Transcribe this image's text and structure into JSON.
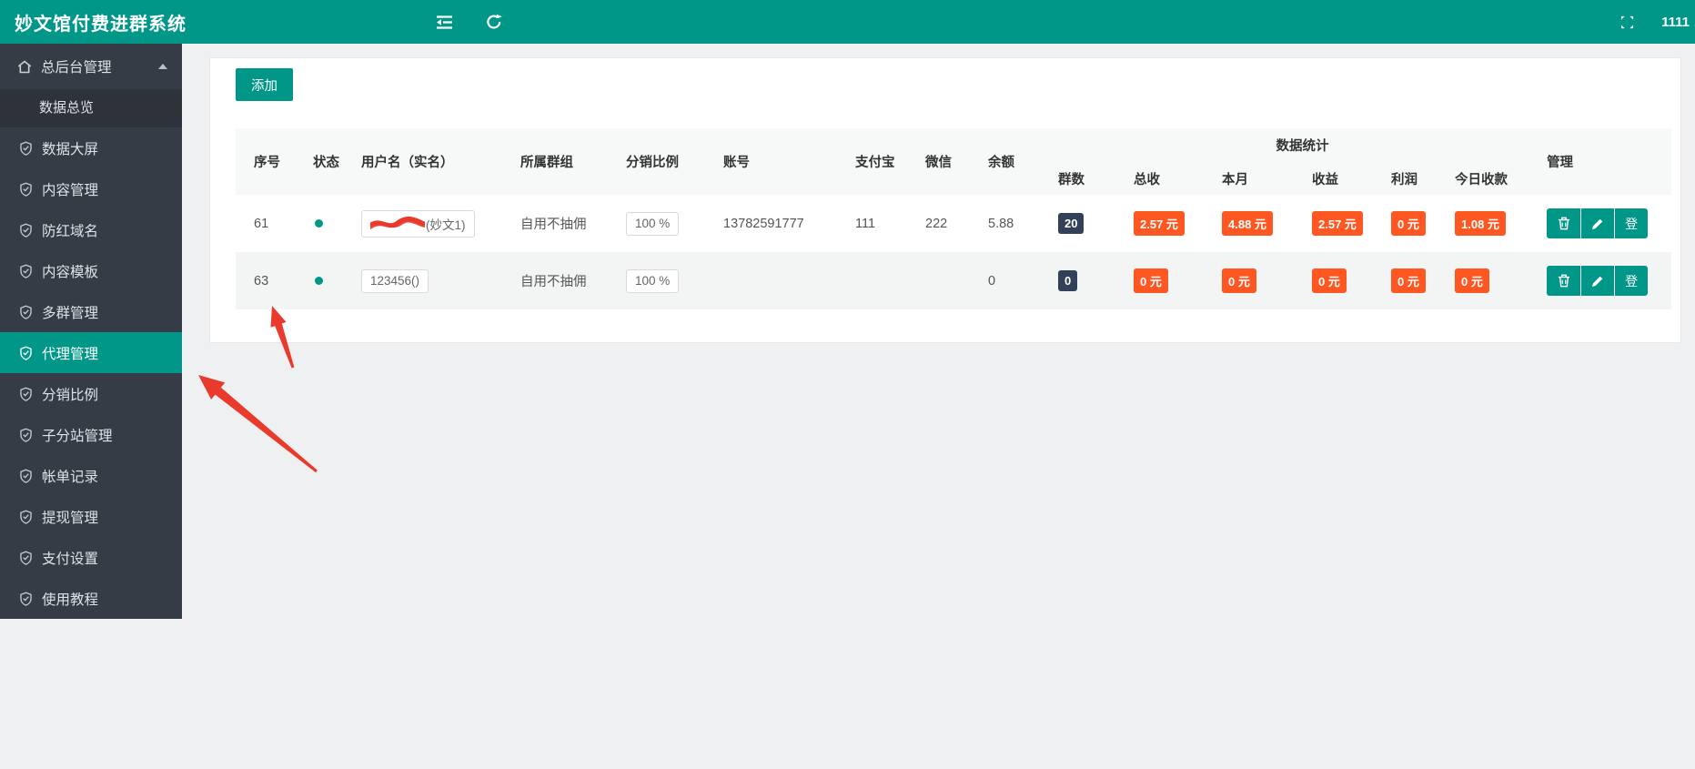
{
  "header": {
    "title": "妙文馆付费进群系统",
    "user": "1111"
  },
  "sidebar": {
    "parent": "总后台管理",
    "overview": "数据总览",
    "items": [
      "数据大屏",
      "内容管理",
      "防红域名",
      "内容模板",
      "多群管理",
      "代理管理",
      "分销比例",
      "子分站管理",
      "帐单记录",
      "提现管理",
      "支付设置",
      "使用教程"
    ],
    "active_item": "代理管理"
  },
  "toolbar": {
    "add": "添加"
  },
  "table": {
    "columns": [
      "序号",
      "状态",
      "用户名（实名）",
      "所属群组",
      "分销比例",
      "账号",
      "支付宝",
      "微信",
      "余额"
    ],
    "stats_group": "数据统计",
    "stats_columns": [
      "群数",
      "总收",
      "本月",
      "收益",
      "利润",
      "今日收款"
    ],
    "manage": "管理",
    "login_button": "登",
    "rows": [
      {
        "seq": "61",
        "status": "online",
        "username": "(妙文1)",
        "username_redacted": true,
        "group": "自用不抽佣",
        "ratio": "100 %",
        "account": "13782591777",
        "alipay": "111",
        "wechat": "222",
        "balance": "5.88",
        "groups": "20",
        "total": "2.57 元",
        "month": "4.88 元",
        "income": "2.57 元",
        "profit": "0 元",
        "today": "1.08 元"
      },
      {
        "seq": "63",
        "status": "online",
        "username": "123456()",
        "username_redacted": false,
        "group": "自用不抽佣",
        "ratio": "100 %",
        "account": "",
        "alipay": "",
        "wechat": "",
        "balance": "0",
        "groups": "0",
        "total": "0 元",
        "month": "0 元",
        "income": "0 元",
        "profit": "0 元",
        "today": "0 元"
      }
    ]
  },
  "colors": {
    "accent": "#009688",
    "sidebar_bg": "#363c46",
    "badge_orange": "#ff5722",
    "badge_dark": "#324157",
    "arrow_red": "#e93a2c",
    "page_bg": "#eff0f1"
  }
}
